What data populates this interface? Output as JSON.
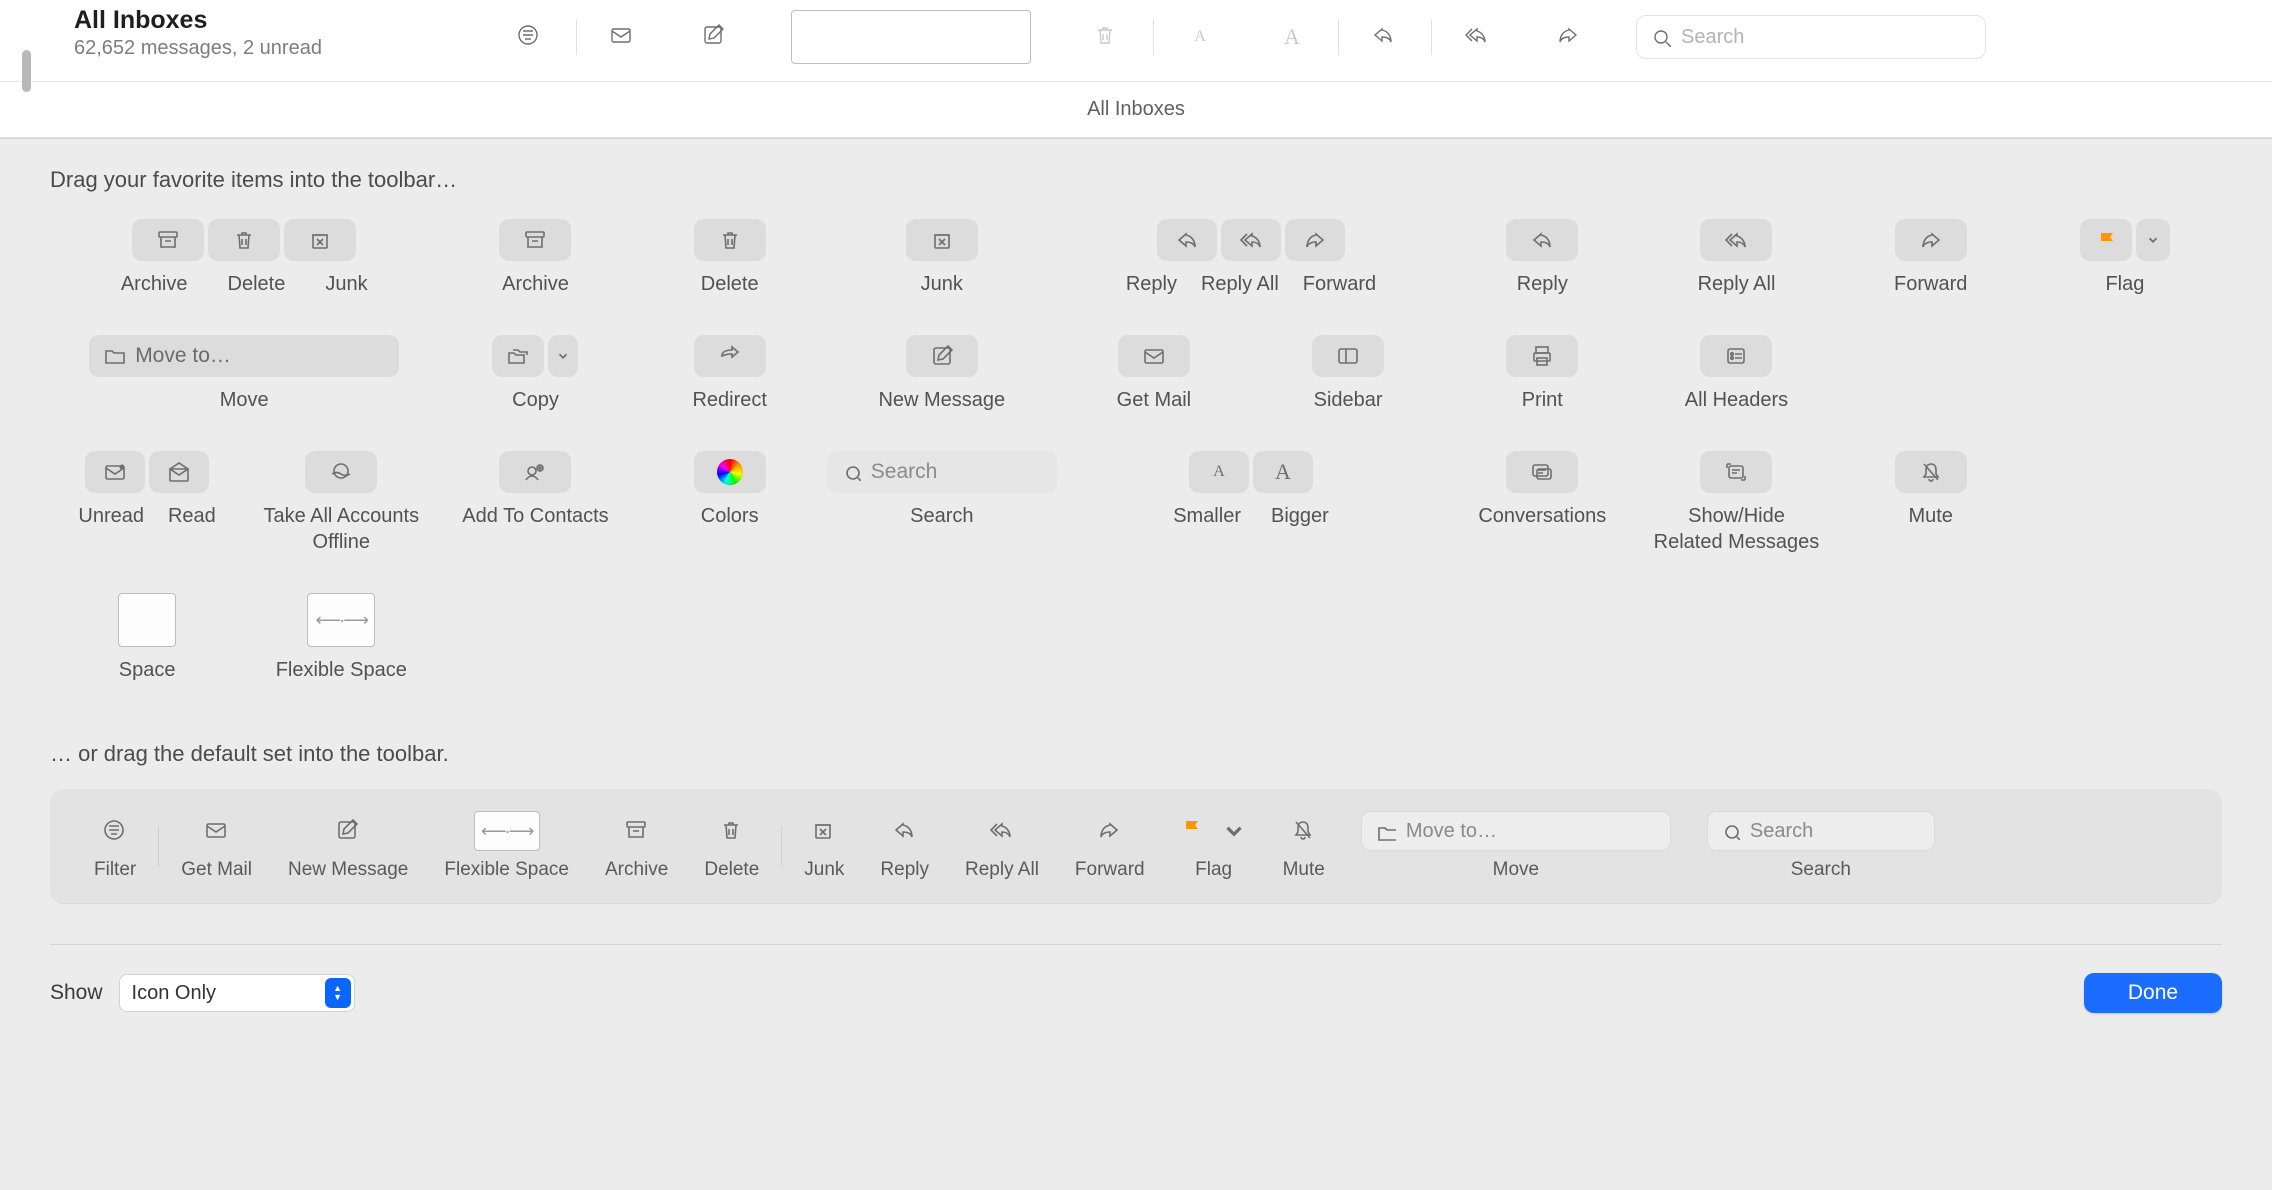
{
  "header": {
    "title": "All Inboxes",
    "subtitle": "62,652 messages, 2 unread",
    "search_placeholder": "Search"
  },
  "subheader": {
    "title": "All Inboxes"
  },
  "sheet": {
    "instruction_top": "Drag your favorite items into the toolbar…",
    "instruction_bottom": "… or drag the default set into the toolbar.",
    "show_label": "Show",
    "show_value": "Icon Only",
    "done_label": "Done"
  },
  "palette": {
    "archive": "Archive",
    "delete": "Delete",
    "junk": "Junk",
    "archive2": "Archive",
    "delete2": "Delete",
    "junk2": "Junk",
    "reply": "Reply",
    "reply_all": "Reply All",
    "forward": "Forward",
    "reply2": "Reply",
    "reply_all2": "Reply All",
    "forward2": "Forward",
    "flag": "Flag",
    "move": "Move",
    "move_placeholder": "Move to…",
    "copy": "Copy",
    "redirect": "Redirect",
    "new_message": "New Message",
    "get_mail": "Get Mail",
    "sidebar": "Sidebar",
    "print": "Print",
    "all_headers": "All Headers",
    "unread": "Unread",
    "read": "Read",
    "take_offline": "Take All Accounts\nOffline",
    "add_contacts": "Add To Contacts",
    "colors": "Colors",
    "search": "Search",
    "search_placeholder": "Search",
    "smaller": "Smaller",
    "bigger": "Bigger",
    "conversations": "Conversations",
    "related": "Show/Hide\nRelated Messages",
    "mute": "Mute",
    "space": "Space",
    "flexible_space": "Flexible Space"
  },
  "default_set": {
    "filter": "Filter",
    "get_mail": "Get Mail",
    "new_message": "New Message",
    "flexible_space": "Flexible Space",
    "archive": "Archive",
    "delete": "Delete",
    "junk": "Junk",
    "reply": "Reply",
    "reply_all": "Reply All",
    "forward": "Forward",
    "flag": "Flag",
    "mute": "Mute",
    "move": "Move",
    "move_placeholder": "Move to…",
    "search": "Search",
    "search_placeholder": "Search"
  }
}
